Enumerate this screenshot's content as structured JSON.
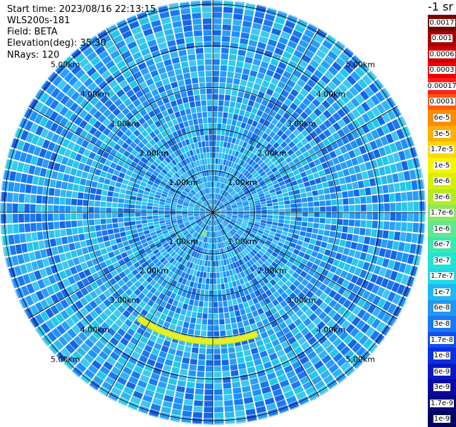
{
  "header": {
    "start_time": "Start time: 2023/08/16 22:13:15",
    "instrument": "WLS200s-181",
    "field": "Field: BETA",
    "elevation": "Elevation(deg): 35.30",
    "nrays": "NRays: 120"
  },
  "colorbar": {
    "title": "-1 sr",
    "labels": [
      "0.0017",
      "0.001",
      "0.0006",
      "0.0003",
      "0.00017",
      "0.0001",
      "6e-5",
      "3e-5",
      "1.7e-5",
      "1e-5",
      "6e-6",
      "3e-6",
      "1.7e-6",
      "1e-6",
      "6e-7",
      "3e-7",
      "1.7e-7",
      "1e-7",
      "6e-8",
      "3e-8",
      "1.7e-8",
      "1e-8",
      "6e-9",
      "3e-9",
      "1.7e-9",
      "1e-9"
    ],
    "colors": [
      "#7a0000",
      "#a80000",
      "#d00000",
      "#f00000",
      "#ff2020",
      "#ff5a00",
      "#ff8c00",
      "#ffb000",
      "#ffd800",
      "#f5f500",
      "#d8f000",
      "#b5ec20",
      "#8ae860",
      "#5ee890",
      "#3ae8b0",
      "#20e4d0",
      "#20d8e8",
      "#20b8f0",
      "#2098f0",
      "#1a78f0",
      "#1050f0",
      "#0a30e0",
      "#0a18c0",
      "#0a0aa0",
      "#060680",
      "#040460"
    ]
  },
  "chart_data": {
    "type": "ppi-polar",
    "field": "BETA",
    "elevation_deg": 35.3,
    "nrays": 120,
    "range_rings_km": [
      1.0,
      2.0,
      3.0,
      4.0,
      5.0
    ],
    "ring_labels": [
      "1.00km",
      "2.00km",
      "3.00km",
      "4.00km",
      "5.00km"
    ],
    "spokes_deg": [
      0,
      30,
      60,
      90,
      120,
      150,
      180,
      210,
      240,
      270,
      300,
      330
    ],
    "max_range_km": 5.1,
    "colorbar_unit": "-1 sr",
    "features": [
      {
        "name": "arc band",
        "range_km": 3.1,
        "azimuth_deg": [
          160,
          215
        ],
        "beta_approx": "1e-5"
      },
      {
        "name": "spot",
        "range_km": 0.55,
        "azimuth_deg": 202,
        "beta_approx": "1e-6"
      }
    ]
  }
}
